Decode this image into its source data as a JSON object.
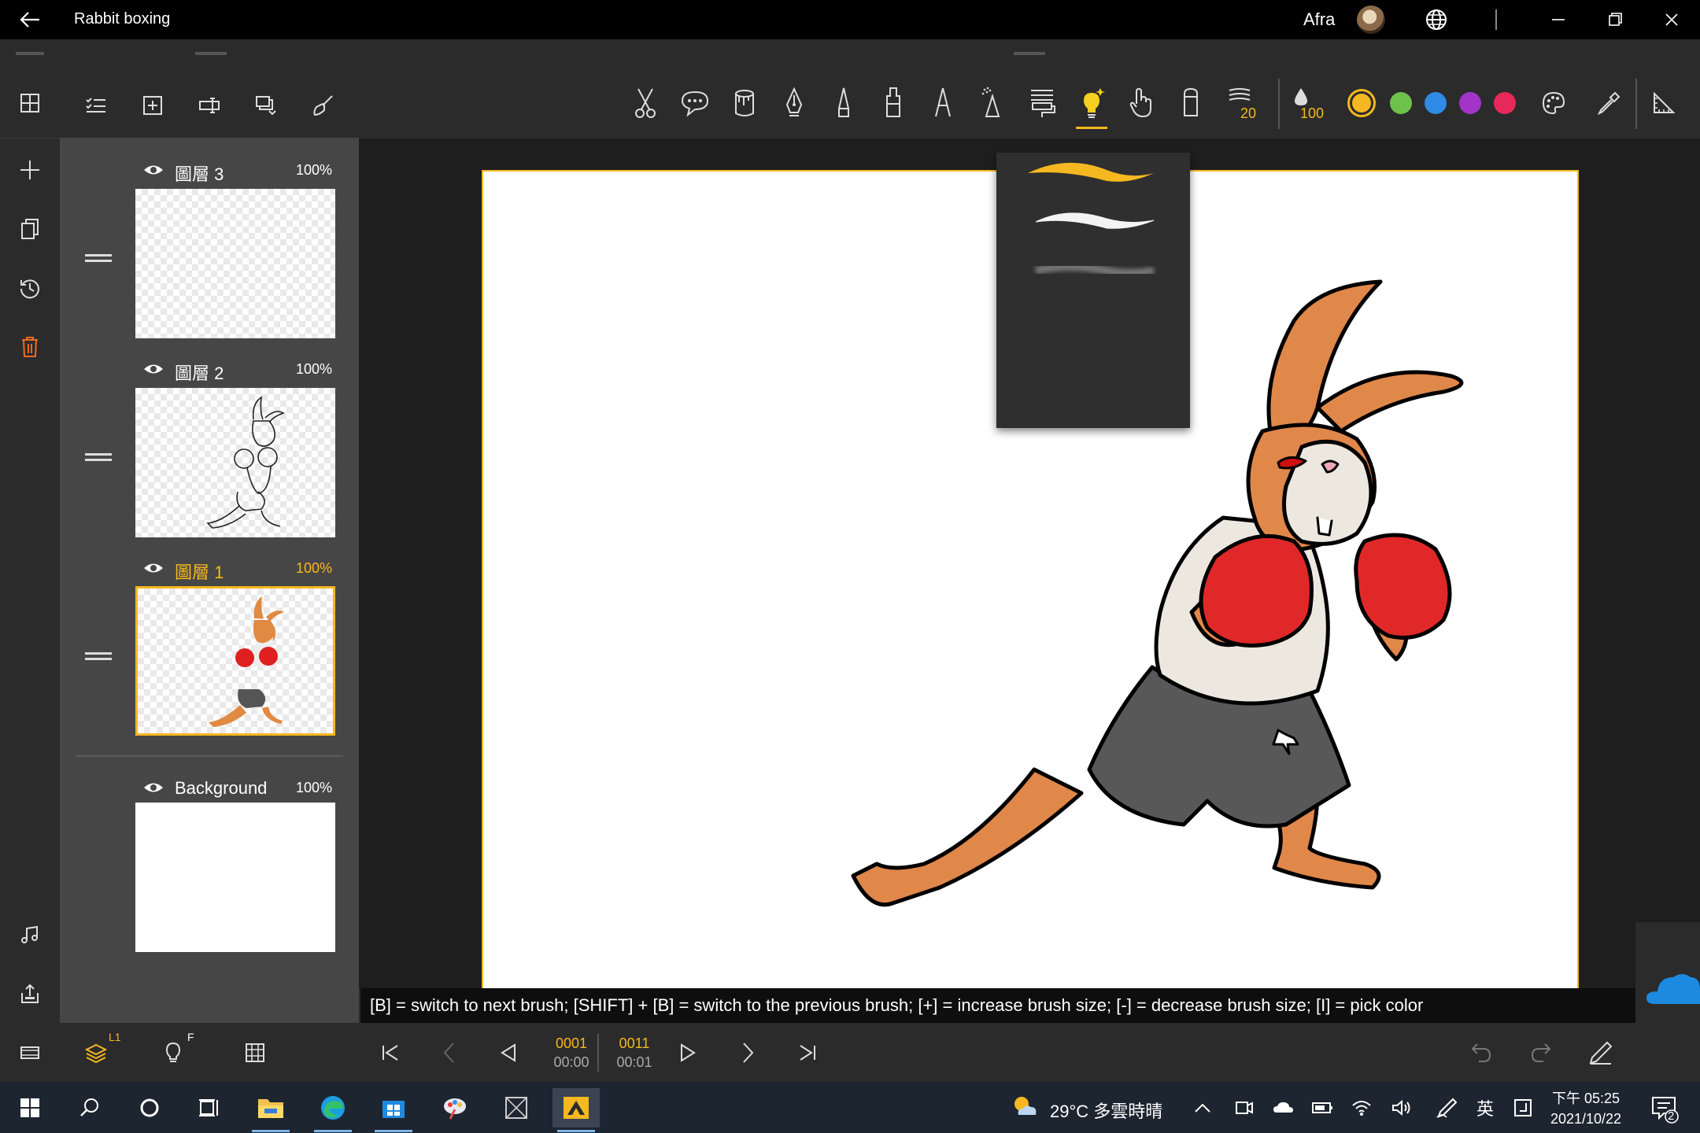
{
  "window": {
    "title": "Rabbit boxing",
    "user": "Afra"
  },
  "layers": [
    {
      "name": "圖層 3",
      "opacity": "100%",
      "active": false
    },
    {
      "name": "圖層 2",
      "opacity": "100%",
      "active": false
    },
    {
      "name": "圖層 1",
      "opacity": "100%",
      "active": true
    },
    {
      "name": "Background",
      "opacity": "100%",
      "active": false
    }
  ],
  "left_bottom": {
    "layers_badge": "L1",
    "onion_badge": "F"
  },
  "toolbar": {
    "brush_size": "20",
    "opacity": "100",
    "selected_tool": "lightbulb-icon",
    "colors": [
      "#f5b820",
      "#6cc24a",
      "#2f8be6",
      "#a234c7",
      "#e8285a"
    ]
  },
  "hint": "[B] = switch to next brush; [SHIFT] + [B] = switch to the previous brush; [+] = increase brush size; [-] = decrease brush size; [I] = pick color",
  "timeline": {
    "current_frame": "0001",
    "current_time": "00:00",
    "total_frame": "0011",
    "total_time": "00:01"
  },
  "taskbar": {
    "weather": "29°C 多雲時晴",
    "ime": "英",
    "time": "下午 05:25",
    "date": "2021/10/22",
    "notifications": "2"
  }
}
